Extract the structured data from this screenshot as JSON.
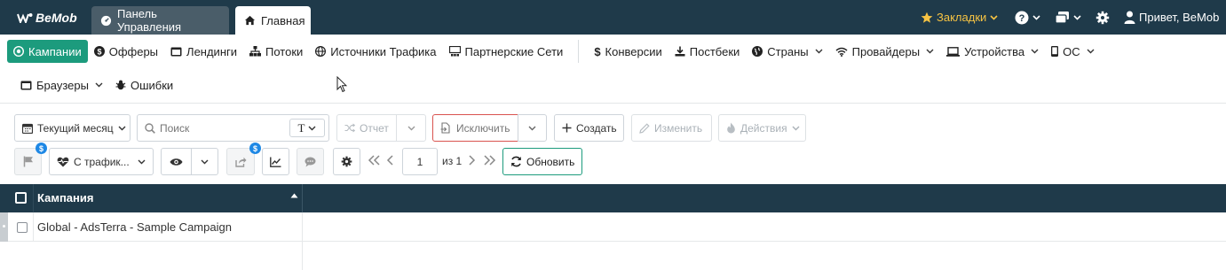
{
  "topbar": {
    "logo": "BeMob",
    "tabs": [
      {
        "label": "Панель Управления"
      },
      {
        "label": "Главная"
      }
    ],
    "bookmarks_label": "Закладки",
    "user_label": "Привет, BeMob"
  },
  "nav": {
    "items": [
      {
        "label": "Кампании"
      },
      {
        "label": "Офферы"
      },
      {
        "label": "Лендинги"
      },
      {
        "label": "Потоки"
      },
      {
        "label": "Источники Трафика"
      },
      {
        "label": "Партнерские Сети"
      },
      {
        "label": "Конверсии"
      },
      {
        "label": "Постбеки"
      },
      {
        "label": "Страны"
      },
      {
        "label": "Провайдеры"
      },
      {
        "label": "Устройства"
      },
      {
        "label": "ОС"
      },
      {
        "label": "Браузеры"
      },
      {
        "label": "Ошибки"
      }
    ]
  },
  "toolbar": {
    "date_range": "Текущий месяц",
    "search_placeholder": "Поиск",
    "search_mode": "T",
    "report_label": "Отчет",
    "exclude_label": "Исключить",
    "create_label": "Создать",
    "edit_label": "Изменить",
    "actions_label": "Действия",
    "traffic_filter": "С трафик...",
    "page_value": "1",
    "page_of": "из 1",
    "refresh_label": "Обновить"
  },
  "table": {
    "columns": [
      "Кампания"
    ],
    "rows": [
      {
        "campaign": "Global - AdsTerra - Sample Campaign"
      }
    ]
  },
  "colors": {
    "header_bg": "#1f3a4a",
    "accent": "#1c9b7d",
    "bookmarks": "#f6c343",
    "danger": "#d9534f",
    "badge": "#1e88e5"
  }
}
